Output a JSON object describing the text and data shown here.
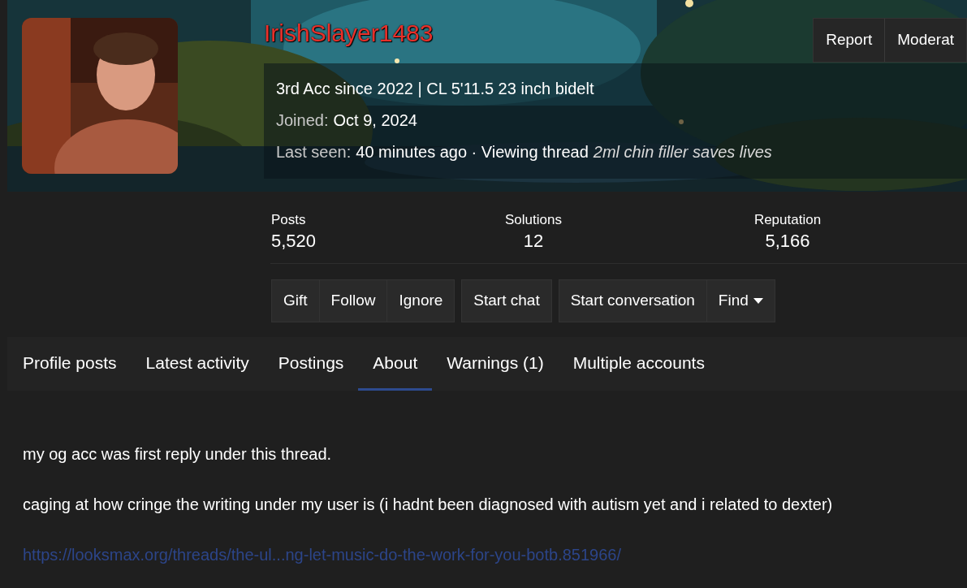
{
  "profile": {
    "username": "IrishSlayer1483",
    "custom_title": "3rd Acc since 2022 | CL 5'11.5 23 inch bidelt",
    "joined_label": "Joined:",
    "joined_value": "Oct 9, 2024",
    "last_seen_label": "Last seen:",
    "last_seen_value": "40 minutes ago · Viewing thread",
    "last_seen_thread": "2ml chin filler saves lives"
  },
  "header_buttons": [
    "Report",
    "Moderat"
  ],
  "stats": [
    {
      "label": "Posts",
      "value": "5,520"
    },
    {
      "label": "Solutions",
      "value": "12"
    },
    {
      "label": "Reputation",
      "value": "5,166"
    }
  ],
  "action_groups": [
    [
      {
        "label": "Gift",
        "kind": "button"
      },
      {
        "label": "Follow",
        "kind": "button"
      },
      {
        "label": "Ignore",
        "kind": "button"
      }
    ],
    [
      {
        "label": "Start chat",
        "kind": "button"
      }
    ],
    [
      {
        "label": "Start conversation",
        "kind": "button"
      },
      {
        "label": "Find",
        "kind": "dropdown"
      }
    ]
  ],
  "tabs": [
    {
      "label": "Profile posts",
      "selected": false
    },
    {
      "label": "Latest activity",
      "selected": false
    },
    {
      "label": "Postings",
      "selected": false
    },
    {
      "label": "About",
      "selected": true
    },
    {
      "label": "Warnings (1)",
      "selected": false
    },
    {
      "label": "Multiple accounts",
      "selected": false
    }
  ],
  "about": [
    {
      "kind": "text",
      "text": "my og acc was first reply under this thread."
    },
    {
      "kind": "text",
      "text": "caging at how cringe the writing under my user is (i hadnt been diagnosed with autism yet and i related to dexter)"
    },
    {
      "kind": "link",
      "text": "https://looksmax.org/threads/the-ul...ng-let-music-do-the-work-for-you-botb.851966/"
    }
  ]
}
